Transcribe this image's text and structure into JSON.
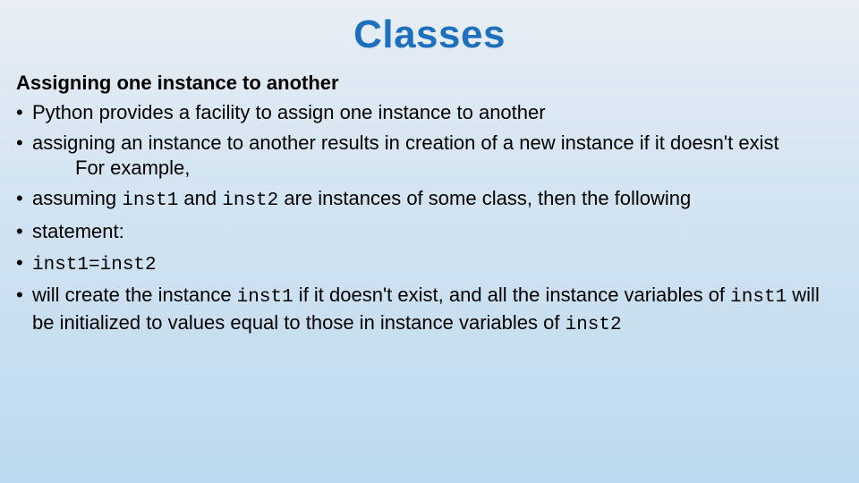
{
  "title": "Classes",
  "subheading": "Assigning one instance to another",
  "bullets": {
    "b0": "Python provides a facility to assign one instance to another",
    "b1_line1": "assigning an instance to another results in creation of a new instance if it doesn't exist",
    "b1_line2": "For example,",
    "b2_pre": "assuming ",
    "b2_c1": "inst1",
    "b2_mid": " and ",
    "b2_c2": "inst2",
    "b2_post": " are instances of some class, then the following",
    "b3": "statement:",
    "b4_code": "inst1=inst2",
    "b5_t1": "will create the instance ",
    "b5_c1": "inst1",
    "b5_t2": " if it doesn't exist, and all the instance variables of ",
    "b5_c2": "inst1",
    "b5_t3": " will be initialized to values equal to those in instance variables of ",
    "b5_c3": "inst2"
  }
}
